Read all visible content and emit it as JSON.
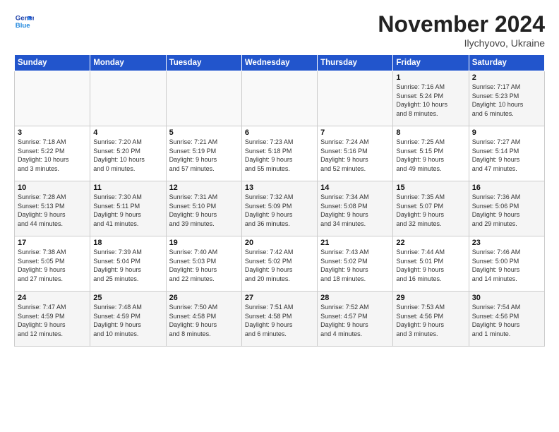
{
  "logo": {
    "text_general": "General",
    "text_blue": "Blue"
  },
  "header": {
    "month": "November 2024",
    "location": "Ilychyovo, Ukraine"
  },
  "weekdays": [
    "Sunday",
    "Monday",
    "Tuesday",
    "Wednesday",
    "Thursday",
    "Friday",
    "Saturday"
  ],
  "weeks": [
    [
      {
        "day": "",
        "detail": ""
      },
      {
        "day": "",
        "detail": ""
      },
      {
        "day": "",
        "detail": ""
      },
      {
        "day": "",
        "detail": ""
      },
      {
        "day": "",
        "detail": ""
      },
      {
        "day": "1",
        "detail": "Sunrise: 7:16 AM\nSunset: 5:24 PM\nDaylight: 10 hours\nand 8 minutes."
      },
      {
        "day": "2",
        "detail": "Sunrise: 7:17 AM\nSunset: 5:23 PM\nDaylight: 10 hours\nand 6 minutes."
      }
    ],
    [
      {
        "day": "3",
        "detail": "Sunrise: 7:18 AM\nSunset: 5:22 PM\nDaylight: 10 hours\nand 3 minutes."
      },
      {
        "day": "4",
        "detail": "Sunrise: 7:20 AM\nSunset: 5:20 PM\nDaylight: 10 hours\nand 0 minutes."
      },
      {
        "day": "5",
        "detail": "Sunrise: 7:21 AM\nSunset: 5:19 PM\nDaylight: 9 hours\nand 57 minutes."
      },
      {
        "day": "6",
        "detail": "Sunrise: 7:23 AM\nSunset: 5:18 PM\nDaylight: 9 hours\nand 55 minutes."
      },
      {
        "day": "7",
        "detail": "Sunrise: 7:24 AM\nSunset: 5:16 PM\nDaylight: 9 hours\nand 52 minutes."
      },
      {
        "day": "8",
        "detail": "Sunrise: 7:25 AM\nSunset: 5:15 PM\nDaylight: 9 hours\nand 49 minutes."
      },
      {
        "day": "9",
        "detail": "Sunrise: 7:27 AM\nSunset: 5:14 PM\nDaylight: 9 hours\nand 47 minutes."
      }
    ],
    [
      {
        "day": "10",
        "detail": "Sunrise: 7:28 AM\nSunset: 5:13 PM\nDaylight: 9 hours\nand 44 minutes."
      },
      {
        "day": "11",
        "detail": "Sunrise: 7:30 AM\nSunset: 5:11 PM\nDaylight: 9 hours\nand 41 minutes."
      },
      {
        "day": "12",
        "detail": "Sunrise: 7:31 AM\nSunset: 5:10 PM\nDaylight: 9 hours\nand 39 minutes."
      },
      {
        "day": "13",
        "detail": "Sunrise: 7:32 AM\nSunset: 5:09 PM\nDaylight: 9 hours\nand 36 minutes."
      },
      {
        "day": "14",
        "detail": "Sunrise: 7:34 AM\nSunset: 5:08 PM\nDaylight: 9 hours\nand 34 minutes."
      },
      {
        "day": "15",
        "detail": "Sunrise: 7:35 AM\nSunset: 5:07 PM\nDaylight: 9 hours\nand 32 minutes."
      },
      {
        "day": "16",
        "detail": "Sunrise: 7:36 AM\nSunset: 5:06 PM\nDaylight: 9 hours\nand 29 minutes."
      }
    ],
    [
      {
        "day": "17",
        "detail": "Sunrise: 7:38 AM\nSunset: 5:05 PM\nDaylight: 9 hours\nand 27 minutes."
      },
      {
        "day": "18",
        "detail": "Sunrise: 7:39 AM\nSunset: 5:04 PM\nDaylight: 9 hours\nand 25 minutes."
      },
      {
        "day": "19",
        "detail": "Sunrise: 7:40 AM\nSunset: 5:03 PM\nDaylight: 9 hours\nand 22 minutes."
      },
      {
        "day": "20",
        "detail": "Sunrise: 7:42 AM\nSunset: 5:02 PM\nDaylight: 9 hours\nand 20 minutes."
      },
      {
        "day": "21",
        "detail": "Sunrise: 7:43 AM\nSunset: 5:02 PM\nDaylight: 9 hours\nand 18 minutes."
      },
      {
        "day": "22",
        "detail": "Sunrise: 7:44 AM\nSunset: 5:01 PM\nDaylight: 9 hours\nand 16 minutes."
      },
      {
        "day": "23",
        "detail": "Sunrise: 7:46 AM\nSunset: 5:00 PM\nDaylight: 9 hours\nand 14 minutes."
      }
    ],
    [
      {
        "day": "24",
        "detail": "Sunrise: 7:47 AM\nSunset: 4:59 PM\nDaylight: 9 hours\nand 12 minutes."
      },
      {
        "day": "25",
        "detail": "Sunrise: 7:48 AM\nSunset: 4:59 PM\nDaylight: 9 hours\nand 10 minutes."
      },
      {
        "day": "26",
        "detail": "Sunrise: 7:50 AM\nSunset: 4:58 PM\nDaylight: 9 hours\nand 8 minutes."
      },
      {
        "day": "27",
        "detail": "Sunrise: 7:51 AM\nSunset: 4:58 PM\nDaylight: 9 hours\nand 6 minutes."
      },
      {
        "day": "28",
        "detail": "Sunrise: 7:52 AM\nSunset: 4:57 PM\nDaylight: 9 hours\nand 4 minutes."
      },
      {
        "day": "29",
        "detail": "Sunrise: 7:53 AM\nSunset: 4:56 PM\nDaylight: 9 hours\nand 3 minutes."
      },
      {
        "day": "30",
        "detail": "Sunrise: 7:54 AM\nSunset: 4:56 PM\nDaylight: 9 hours\nand 1 minute."
      }
    ]
  ]
}
